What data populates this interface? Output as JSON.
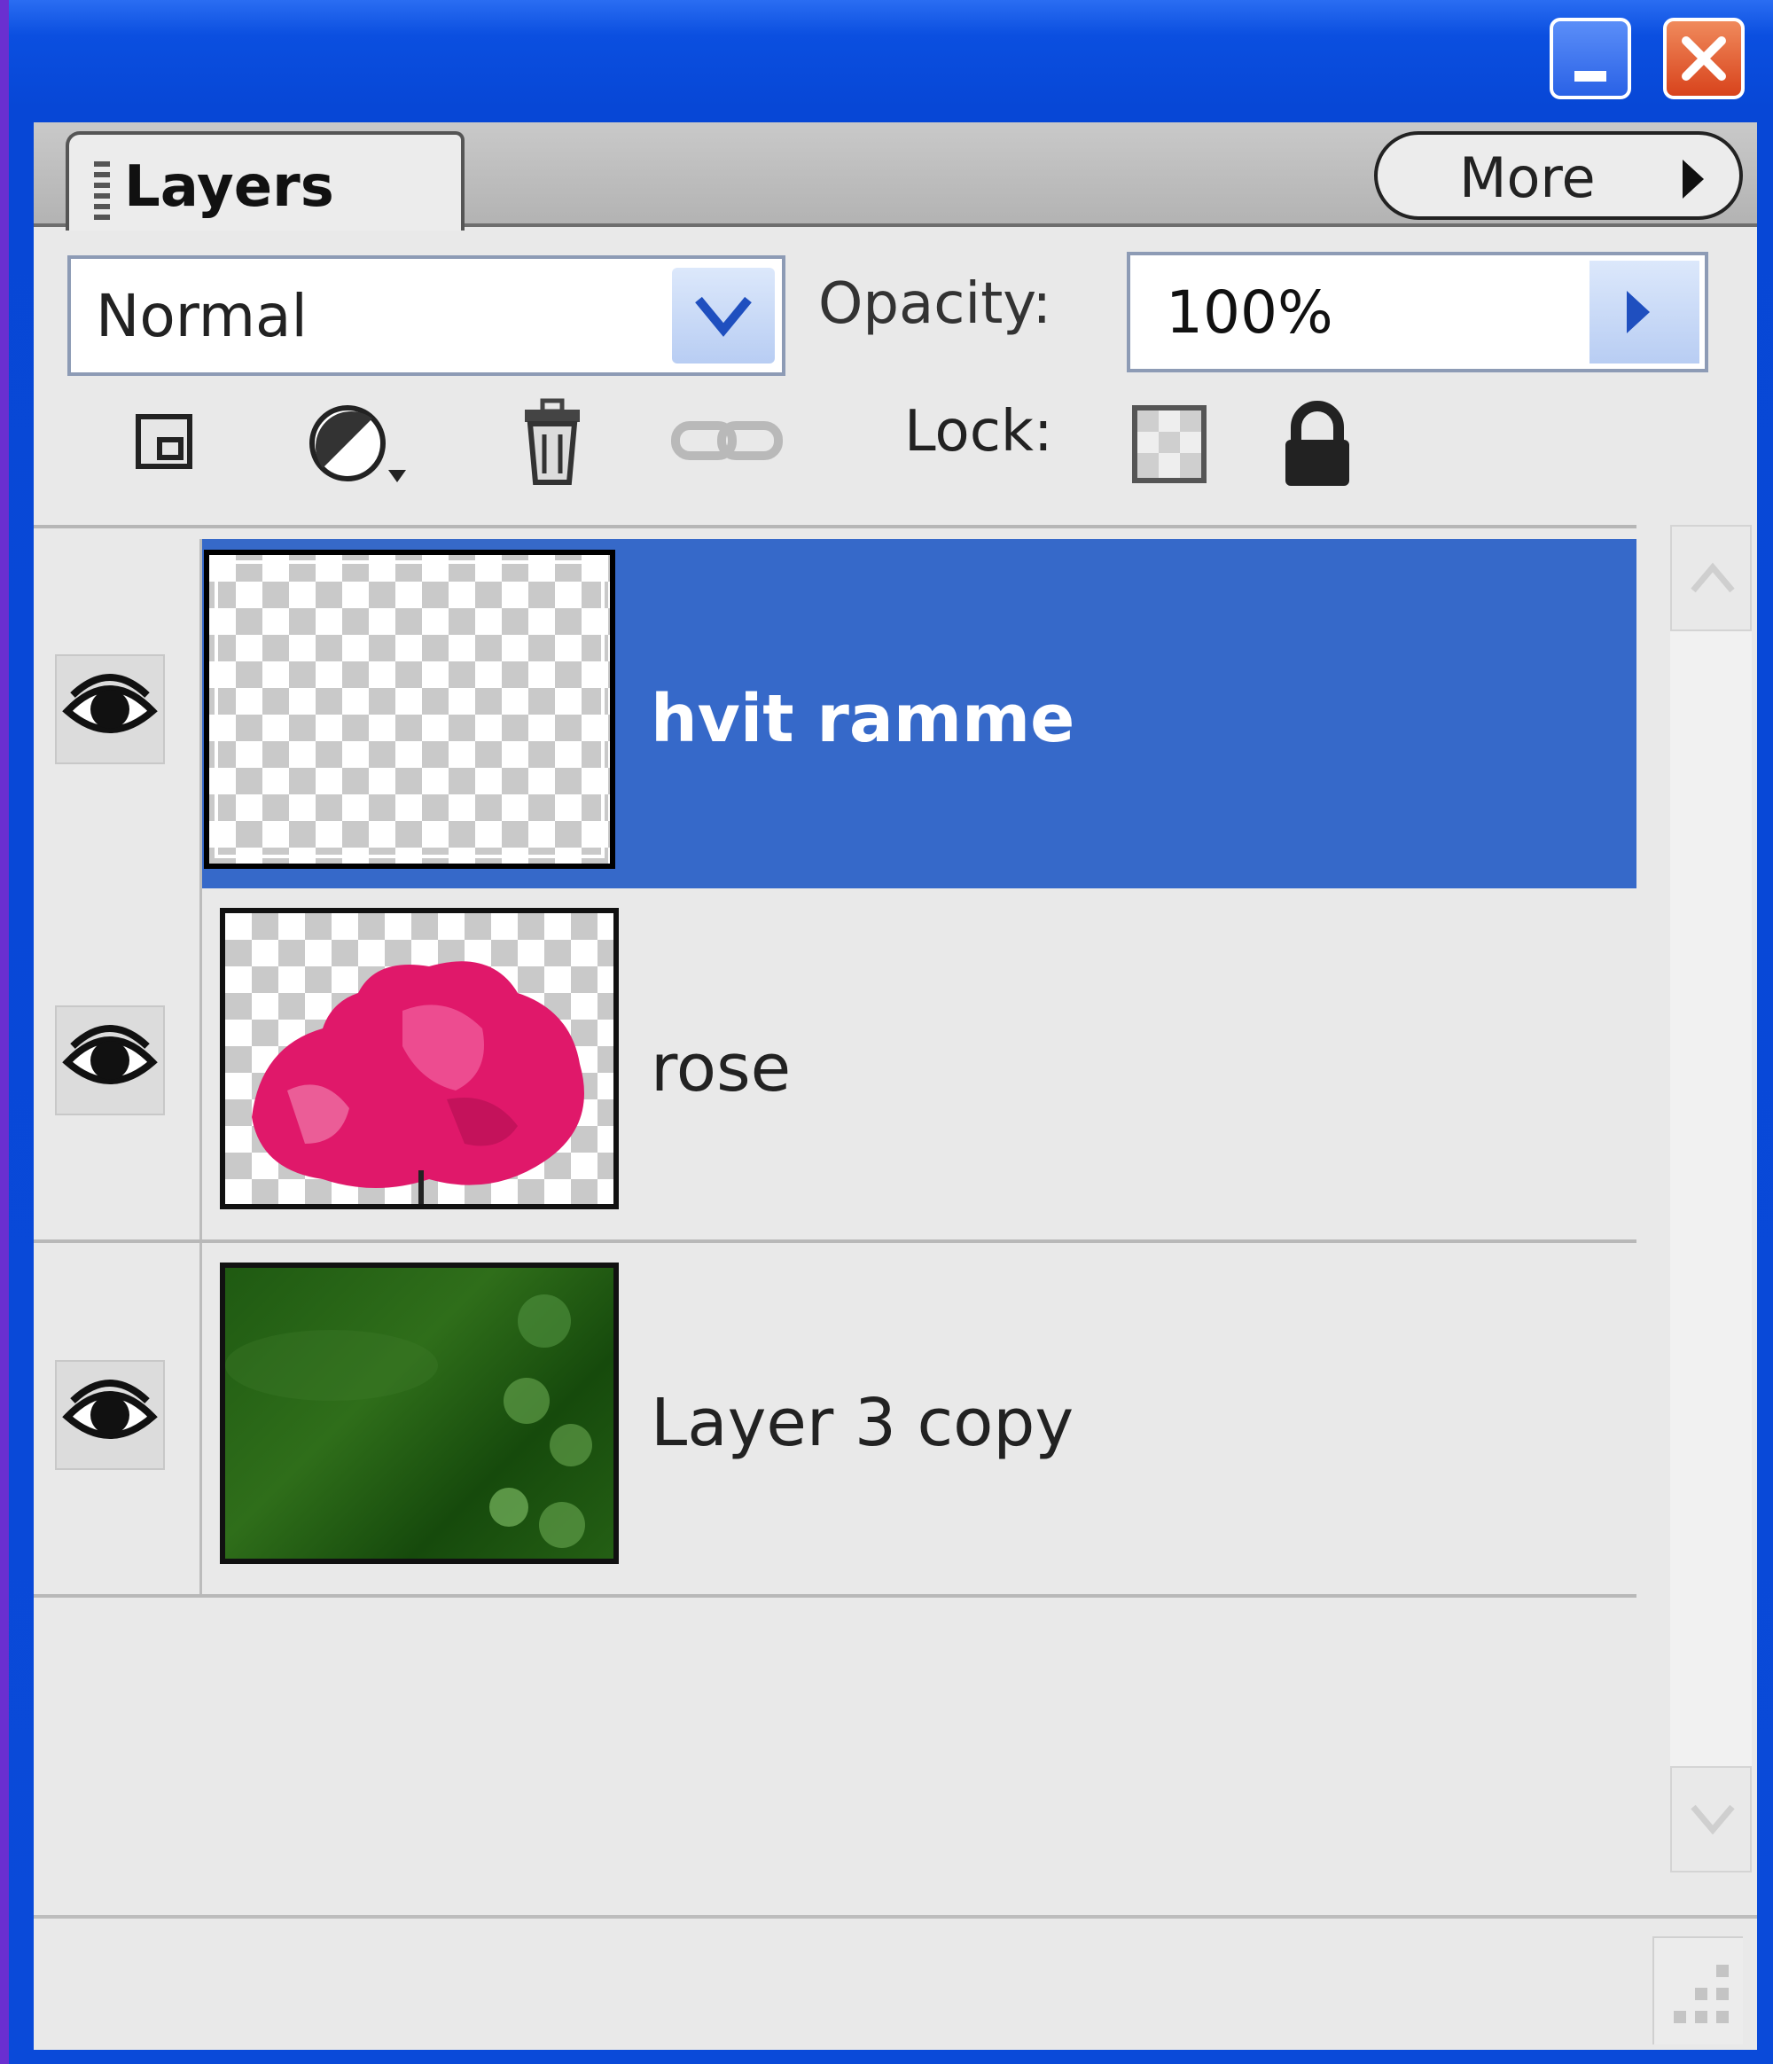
{
  "panel": {
    "tab_label": "Layers",
    "more_label": "More"
  },
  "controls": {
    "blend_mode": "Normal",
    "opacity_label": "Opacity:",
    "opacity_value": "100%",
    "lock_label": "Lock:"
  },
  "icons": {
    "new_layer": "new-layer-icon",
    "adjustment": "adjustment-layer-icon",
    "delete": "trash-icon",
    "link": "link-icon",
    "lock_transparency": "lock-transparency-icon",
    "lock_all": "lock-icon",
    "visibility": "eye-icon"
  },
  "layers": [
    {
      "name": "hvit ramme",
      "selected": true,
      "thumbnail": "transparent"
    },
    {
      "name": "rose",
      "selected": false,
      "thumbnail": "rose"
    },
    {
      "name": "Layer 3 copy",
      "selected": false,
      "thumbnail": "green"
    }
  ],
  "colors": {
    "selection": "#3669c9",
    "panel_bg": "#e9e9e9",
    "titlebar": "#0a4ad9"
  }
}
